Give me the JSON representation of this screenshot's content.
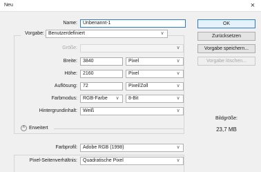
{
  "window": {
    "title": "Neu",
    "close_glyph": "×"
  },
  "fields": {
    "name": {
      "label": "Name:",
      "value": "Unbenannt-1"
    },
    "vorgabe": {
      "label": "Vorgabe:",
      "value": "Benutzerdefiniert"
    },
    "groesse": {
      "label": "Größe:",
      "value": ""
    },
    "breite": {
      "label": "Breite:",
      "value": "3840",
      "unit": "Pixel"
    },
    "hoehe": {
      "label": "Höhe:",
      "value": "2160",
      "unit": "Pixel"
    },
    "aufloesung": {
      "label": "Auflösung:",
      "value": "72",
      "unit": "Pixel/Zoll"
    },
    "farbmodus": {
      "label": "Farbmodus:",
      "value": "RGB-Farbe",
      "depth": "8-Bit"
    },
    "hintergrund": {
      "label": "Hintergrundinhalt:",
      "value": "Weiß"
    },
    "erweitert": {
      "label": "Erweitert",
      "icon": "expand-collapse-icon"
    },
    "farbprofil": {
      "label": "Farbprofil:",
      "value": "Adobe RGB (1998)"
    },
    "pixelverhaeltnis": {
      "label": "Pixel-Seitenverhältnis:",
      "value": "Quadratische Pixel"
    }
  },
  "buttons": {
    "ok": "OK",
    "reset": "Zurücksetzen",
    "save_preset": "Vorgabe speichern...",
    "delete_preset": "Vorgabe löschen..."
  },
  "info": {
    "image_size_label": "Bildgröße:",
    "image_size_value": "23,7 MB"
  },
  "colors": {
    "accent": "#2a7bd1",
    "dialog_bg": "#f0f0f0"
  }
}
